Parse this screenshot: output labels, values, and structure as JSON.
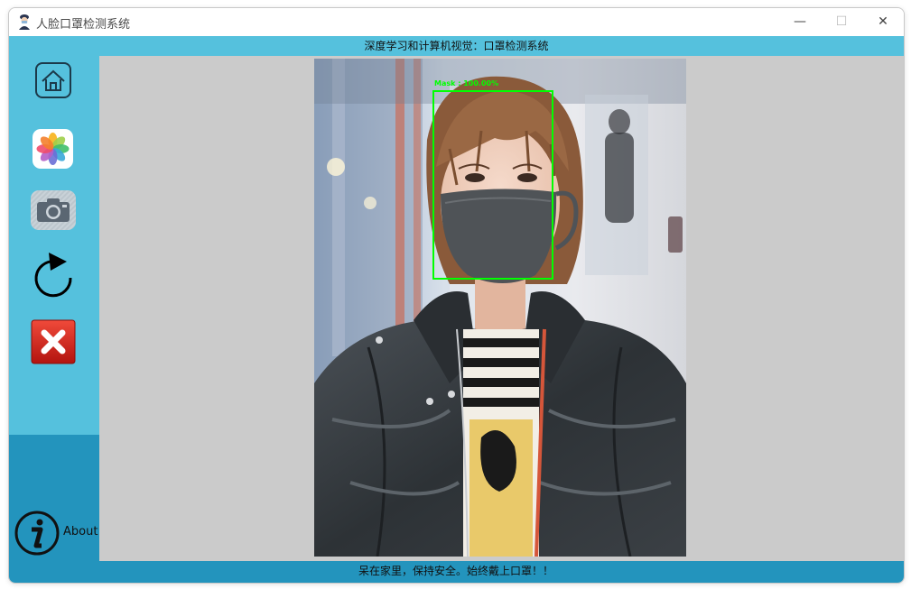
{
  "window": {
    "title": "人脸口罩检测系统",
    "controls": {
      "minimize": "—",
      "maximize": "☐",
      "close": "✕"
    }
  },
  "header": {
    "text": "深度学习和计算机视觉：口罩检测系统"
  },
  "sidebar": {
    "buttons": [
      {
        "name": "home",
        "icon": "home-icon"
      },
      {
        "name": "open-image",
        "icon": "photos-icon"
      },
      {
        "name": "camera",
        "icon": "camera-icon"
      },
      {
        "name": "refresh",
        "icon": "refresh-icon"
      },
      {
        "name": "exit",
        "icon": "close-red-icon"
      }
    ],
    "about": {
      "label": "About",
      "icon": "info-icon"
    }
  },
  "detection": {
    "label": "Mask : 100.00%",
    "box_color": "#00ff00"
  },
  "footer": {
    "text": "呆在家里，保持安全。始终戴上口罩！！"
  },
  "colors": {
    "header": "#55c1dd",
    "sidebar": "#55c1dd",
    "sidebar_bottom": "#2394bd",
    "footer": "#2394bd",
    "main_bg": "#cbcbcb"
  }
}
